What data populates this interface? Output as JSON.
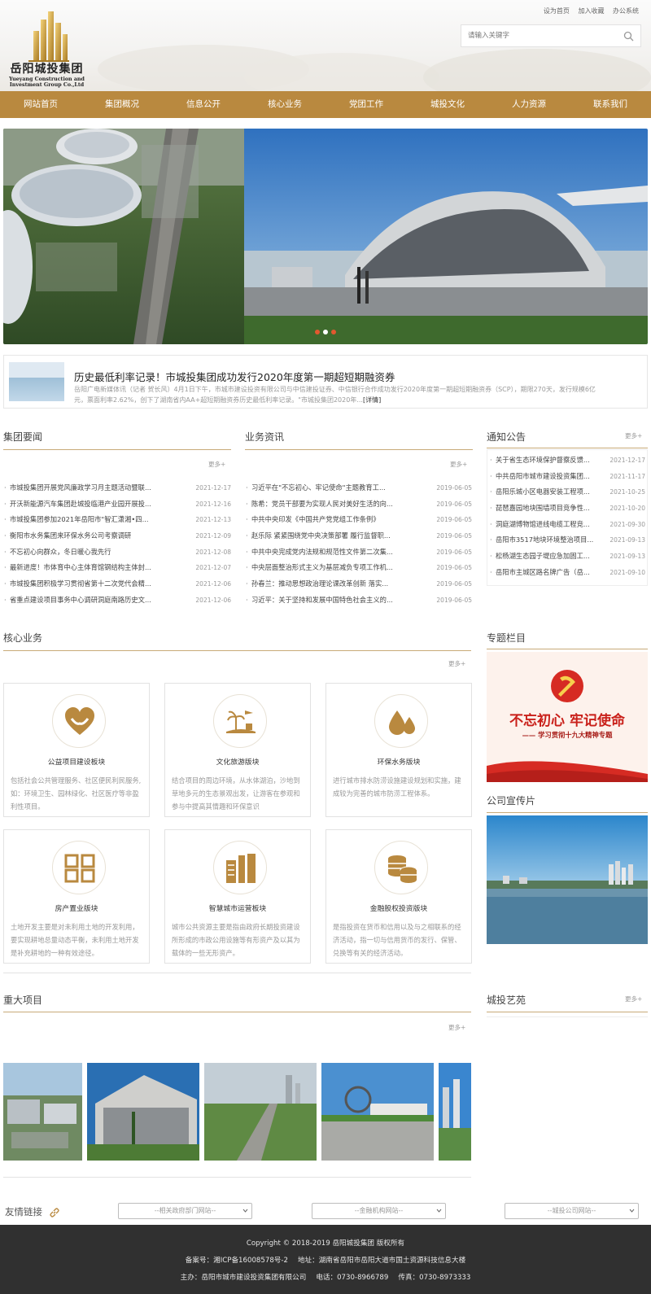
{
  "header": {
    "logo_name": "岳阳城投集团",
    "logo_en_1": "Yueyang Construction and",
    "logo_en_2": "Investment Group Co.,Ltd",
    "top_links": [
      "设为首页",
      "加入收藏",
      "办公系统"
    ],
    "search_placeholder": "请输入关键字"
  },
  "nav": [
    "网站首页",
    "集团概况",
    "信息公开",
    "核心业务",
    "党团工作",
    "城投文化",
    "人力资源",
    "联系我们"
  ],
  "headline": {
    "title": "历史最低利率记录！市城投集团成功发行2020年度第一期超短期融资券",
    "desc": "岳阳广电新媒体讯（记者 贺长风）4月1日下午，市城市建设投资有限公司与中信建投证券、中信银行合作成功发行2020年度第一期超短期融资券（SCP），期限270天，发行规模6亿元，票面利率2.62%，创下了湖南省内AA+超短期融资券历史最低利率记录。\"市城投集团2020年...",
    "more": "[详情]"
  },
  "group_news": {
    "title": "集团要闻",
    "more": "更多+",
    "items": [
      {
        "text": "市城投集团开展党风廉政学习月主题活动暨联...",
        "date": "2021-12-17"
      },
      {
        "text": "开沃新能源汽车集团赴城投临港产业园开展投...",
        "date": "2021-12-16"
      },
      {
        "text": "市城投集团参加2021年岳阳市\"智汇潇湘•四...",
        "date": "2021-12-13"
      },
      {
        "text": "衡阳市水务集团来环保水务公司考察调研",
        "date": "2021-12-09"
      },
      {
        "text": "不忘初心向群众，冬日暖心我先行",
        "date": "2021-12-08"
      },
      {
        "text": "最新进度！市体育中心主体育馆钢结构主体封...",
        "date": "2021-12-07"
      },
      {
        "text": "市城投集团积极学习贯彻省第十二次党代会精...",
        "date": "2021-12-06"
      },
      {
        "text": "省重点建设项目事务中心调研洞庭南路历史文...",
        "date": "2021-12-06"
      }
    ]
  },
  "business_news": {
    "title": "业务资讯",
    "more": "更多+",
    "items": [
      {
        "text": "习近平在\"不忘初心、牢记使命\"主题教育工...",
        "date": "2019-06-05"
      },
      {
        "text": "陈希：党员干部要为实现人民对美好生活的向...",
        "date": "2019-06-05"
      },
      {
        "text": "中共中央印发《中国共产党党组工作条例》",
        "date": "2019-06-05"
      },
      {
        "text": "赵乐际 紧紧围绕党中央决策部署 履行监督职...",
        "date": "2019-06-05"
      },
      {
        "text": "中共中央完成党内法规和规范性文件第二次集...",
        "date": "2019-06-05"
      },
      {
        "text": "中央层面整治形式主义为基层减负专项工作机...",
        "date": "2019-06-05"
      },
      {
        "text": "孙春兰：推动思想政治理论课改革创新 落实...",
        "date": "2019-06-05"
      },
      {
        "text": "习近平：关于坚持和发展中国特色社会主义的...",
        "date": "2019-06-05"
      }
    ]
  },
  "notices": {
    "title": "通知公告",
    "more": "更多+",
    "items": [
      {
        "text": "关于省生态环境保护督察反馈...",
        "date": "2021-12-17"
      },
      {
        "text": "中共岳阳市城市建设投资集团...",
        "date": "2021-11-17"
      },
      {
        "text": "岳阳乐城小区电器安装工程项...",
        "date": "2021-10-25"
      },
      {
        "text": "琵琶嘉园地块围墙项目竞争性...",
        "date": "2021-10-20"
      },
      {
        "text": "洞庭湖博物馆进线电缆工程竞...",
        "date": "2021-09-30"
      },
      {
        "text": "岳阳市3517地块环境整治项目...",
        "date": "2021-09-13"
      },
      {
        "text": "松杨湖生态园子堤应急加固工...",
        "date": "2021-09-13"
      },
      {
        "text": "岳阳市主城区路名牌广告（岳...",
        "date": "2021-09-10"
      }
    ]
  },
  "core_business": {
    "title": "核心业务",
    "more": "更多+",
    "cards": [
      {
        "icon": "heart-hands-icon",
        "title": "公益项目建设板块",
        "desc": "包括社会公共管理服务、社区便民利民服务,如：环境卫生、园林绿化、社区医疗等非盈利性项目。"
      },
      {
        "icon": "palm-plane-icon",
        "title": "文化旅游版块",
        "desc": "结合项目的周边环境，从水体湖泊，沙地到草地多元的生态景观出发，让游客在参观和参与中提高其情趣和环保意识"
      },
      {
        "icon": "water-drops-icon",
        "title": "环保水务版块",
        "desc": "进行城市排水防涝设施建设规划和实施，建成较为完善的城市防涝工程体系。"
      },
      {
        "icon": "blocks-icon",
        "title": "房产置业版块",
        "desc": "土地开发主要是对未利用土地的开发利用，要实现耕地总量动态平衡，未利用土地开发是补充耕地的一种有效途径。"
      },
      {
        "icon": "buildings-icon",
        "title": "智慧城市运营板块",
        "desc": "城市公共资源主要是指由政府长期投资建设所形成的市政公用设施等有形资产及以其为载体的一些无形资产。"
      },
      {
        "icon": "coins-icon",
        "title": "金融股权投资版块",
        "desc": "是指投资在货币和信用以及与之相联系的经济活动，指一切与信用货币的发行、保管、兑换等有关的经济活动。"
      }
    ]
  },
  "special": {
    "title": "专题栏目",
    "slogan": "不忘初心 牢记使命",
    "subtitle": "—— 学习贯彻十九大精神专题"
  },
  "promo": {
    "title": "公司宣传片"
  },
  "projects": {
    "title": "重大项目",
    "more": "更多+"
  },
  "art": {
    "title": "城投艺苑",
    "more": "更多+"
  },
  "friends": {
    "label": "友情链接",
    "selects": [
      "--相关政府部门网站--",
      "--金融机构网站--",
      "--城投公司网站--"
    ]
  },
  "footer": {
    "copyright": "Copyright © 2018-2019 岳阳城投集团 版权所有",
    "icp": "备案号：湘ICP备16008578号-2",
    "address": "地址：湖南省岳阳市岳阳大道市国土资源科技信息大楼",
    "host": "主办：岳阳市城市建设投资集团有限公司",
    "phone": "电话：0730-8966789",
    "fax": "传真：0730-8973333"
  },
  "colors": {
    "brand": "#b9893f",
    "line": "#c8aa78",
    "footer": "#303030"
  }
}
